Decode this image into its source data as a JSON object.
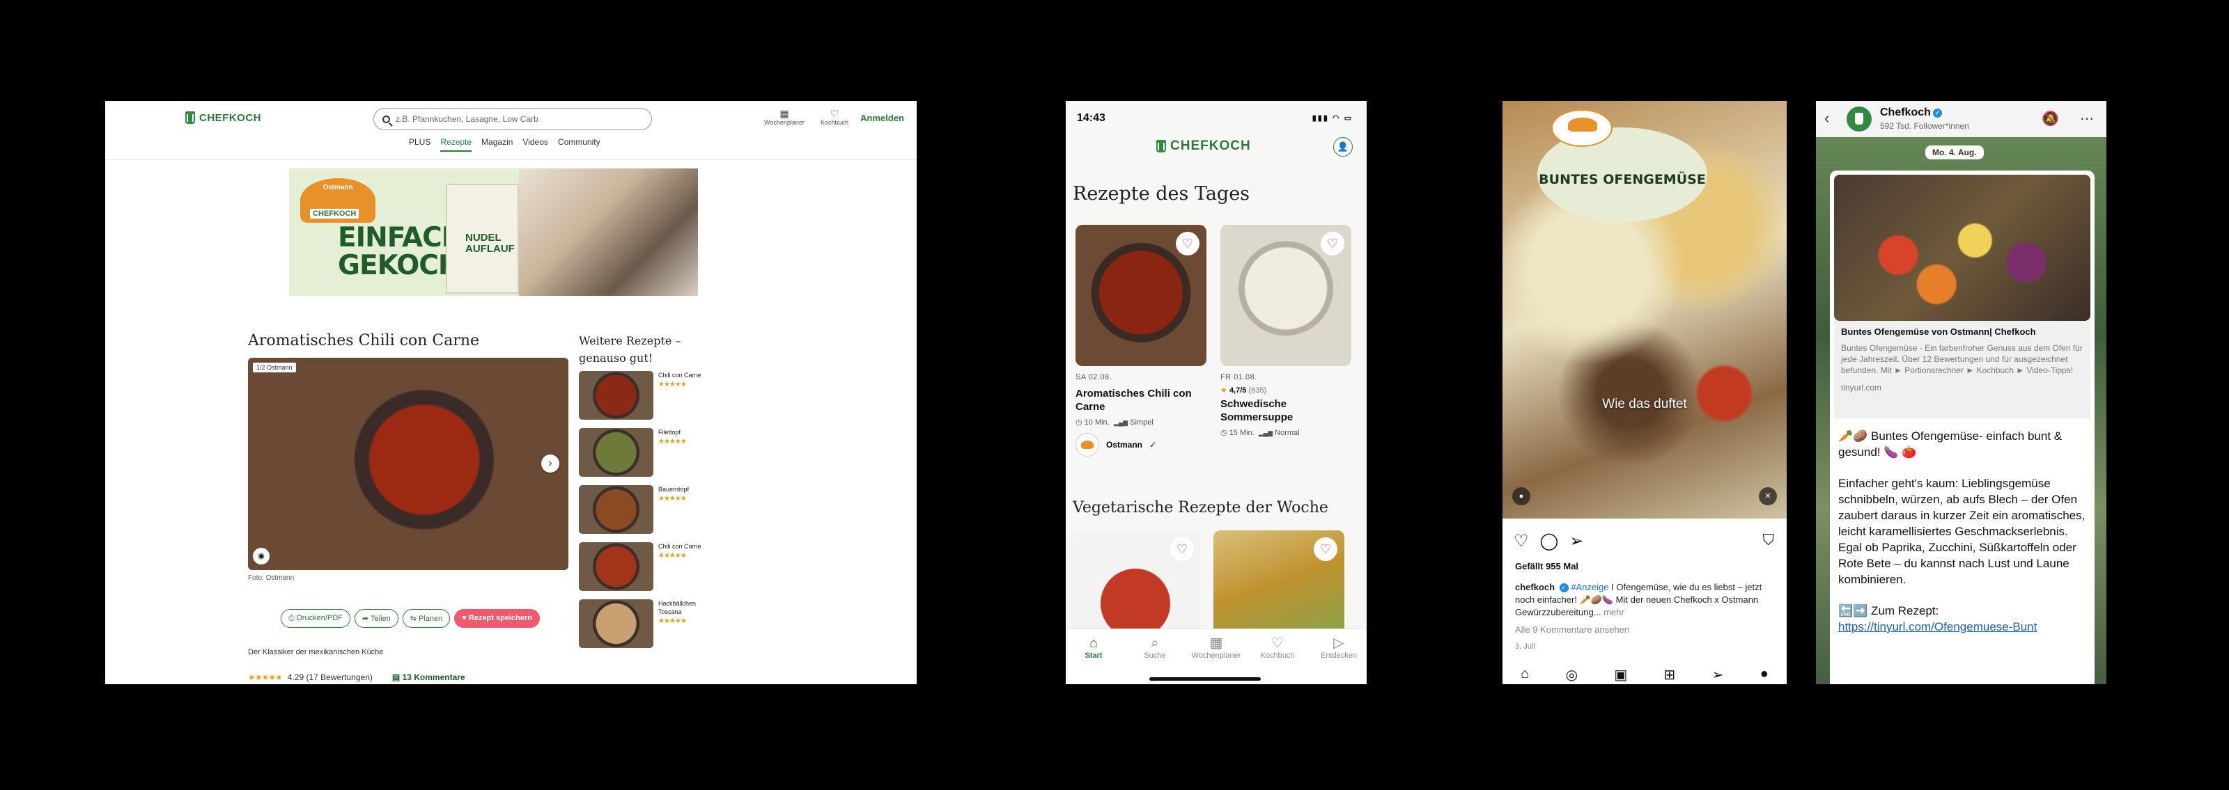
{
  "desktop": {
    "logo": "CHEFKOCH",
    "search_placeholder": "z.B. Pfannkuchen, Lasagne, Low Carb",
    "util": [
      {
        "icon": "calendar-icon",
        "label": "Wochenplaner"
      },
      {
        "icon": "heart-icon",
        "label": "Kochbuch"
      }
    ],
    "login": "Anmelden",
    "nav": [
      "PLUS",
      "Rezepte",
      "Magazin",
      "Videos",
      "Community"
    ],
    "banner": {
      "brand": "Ostmann",
      "brand2": "CHEFKOCH",
      "headline": "EINFACH GEKOCHT",
      "pack": "NUDEL AUFLAUF"
    },
    "recipe_title": "Aromatisches Chili con Carne",
    "image_counter": "1/2 Ostmann",
    "photo_credit": "Foto: Ostmann",
    "actions": [
      "Drucken/PDF",
      "Teilen",
      "Planen",
      "Rezept speichern"
    ],
    "subtitle": "Der Klassiker der mexikanischen Küche",
    "rating": 4.29,
    "rating_text": "4.29 (17 Bewertungen)",
    "comments": "13 Kommentare",
    "side_title": "Weitere Rezepte – genauso gut!",
    "side": [
      {
        "name": "Chili con Carne",
        "stars": 4.5,
        "color": "#8a2a16"
      },
      {
        "name": "Filettopf",
        "stars": 4.5,
        "color": "#6d7a3a"
      },
      {
        "name": "Bauerntopf",
        "stars": 4.5,
        "color": "#8a4a22"
      },
      {
        "name": "Chili con Carne",
        "stars": 4.5,
        "color": "#a23418"
      },
      {
        "name": "Hackbällchen Toscana",
        "stars": 4.5,
        "color": "#c8a072"
      }
    ]
  },
  "app": {
    "time": "14:43",
    "logo": "CHEFKOCH",
    "section1": "Rezepte des Tages",
    "cards": [
      {
        "date": "SA 02.08.",
        "name": "Aromatisches Chili con Carne",
        "time": "10 Min.",
        "level": "Simpel",
        "brand": "Ostmann",
        "color": "#7d2314"
      },
      {
        "date": "FR 01.08.",
        "name": "Schwedische Sommersuppe",
        "rating": "4,7/5",
        "count": "(635)",
        "time": "15 Min.",
        "level": "Normal",
        "color": "#d9d6c8"
      }
    ],
    "section2": "Vegetarische Rezepte der Woche",
    "veg_colors": [
      "#c23a25",
      "#cfa03c"
    ],
    "tabs": [
      {
        "label": "Start",
        "icon": "home-icon"
      },
      {
        "label": "Suche",
        "icon": "search-icon"
      },
      {
        "label": "Wochenplaner",
        "icon": "calendar-icon"
      },
      {
        "label": "Kochbuch",
        "icon": "heart-icon"
      },
      {
        "label": "Entdecken",
        "icon": "play-icon"
      }
    ]
  },
  "instagram": {
    "bubble_logo": "Ostmann",
    "bubble_text": "BUNTES OFENGEMÜSE",
    "video_caption": "Wie das duftet",
    "likes": "Gefällt 955 Mal",
    "user": "chefkoch",
    "tag": "#Anzeige",
    "caption": "I Ofengemüse, wie du es liebst – jetzt noch einfacher! 🥕🥔🍆 Mit der neuen Chefkoch x Ostmann Gewürzzubereitung...",
    "more": "mehr",
    "all_comments": "Alle 9 Kommentare ansehen",
    "date": "3. Juli"
  },
  "whatsapp": {
    "channel": "Chefkoch",
    "followers": "592 Tsd. Follower*innen",
    "day": "Mo. 4. Aug.",
    "preview_title": "Buntes Ofengemüse von Ostmann| Chefkoch",
    "preview_desc": "Buntes Ofengemüse - Ein farbenfroher Genuss aus dem Ofen für jede Jahreszeit. Über 12 Bewertungen und für ausgezeichnet befunden. Mit ► Portionsrechner ► Kochbuch ► Video-Tipps!",
    "preview_url": "tinyurl.com",
    "p1": "🥕🥔 Buntes Ofengemüse- einfach bunt & gesund! 🍆 🍅",
    "p2": "Einfacher geht's kaum: Lieblingsgemüse schnibbeln, würzen, ab aufs Blech – der Ofen zaubert daraus in kurzer Zeit ein aromatisches, leicht karamellisiertes Geschmackserlebnis. Egal ob Paprika, Zucchini, Süßkartoffeln oder Rote Bete – du kannst nach Lust und Laune kombinieren.",
    "link_prefix": "🔚➡️ Zum Rezept:",
    "link": "https://tinyurl.com/Ofengemuese-Bunt"
  }
}
